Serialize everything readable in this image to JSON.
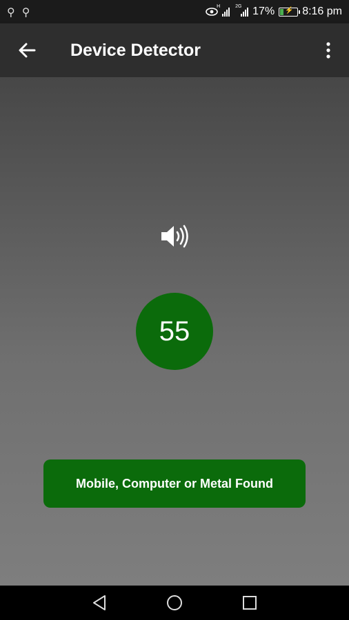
{
  "status_bar": {
    "battery_percent": "17%",
    "time": "8:16 pm",
    "signal1_tag": "H",
    "signal2_tag": "2G"
  },
  "app_bar": {
    "title": "Device Detector"
  },
  "detector": {
    "reading": "55",
    "result_label": "Mobile, Computer or Metal Found",
    "indicator_color": "#0b6b0b"
  },
  "icons": [
    "usb-icon",
    "eye-icon",
    "signal-icon",
    "battery-icon",
    "back-arrow-icon",
    "overflow-menu-icon",
    "speaker-icon",
    "nav-back-icon",
    "nav-home-icon",
    "nav-recents-icon"
  ]
}
